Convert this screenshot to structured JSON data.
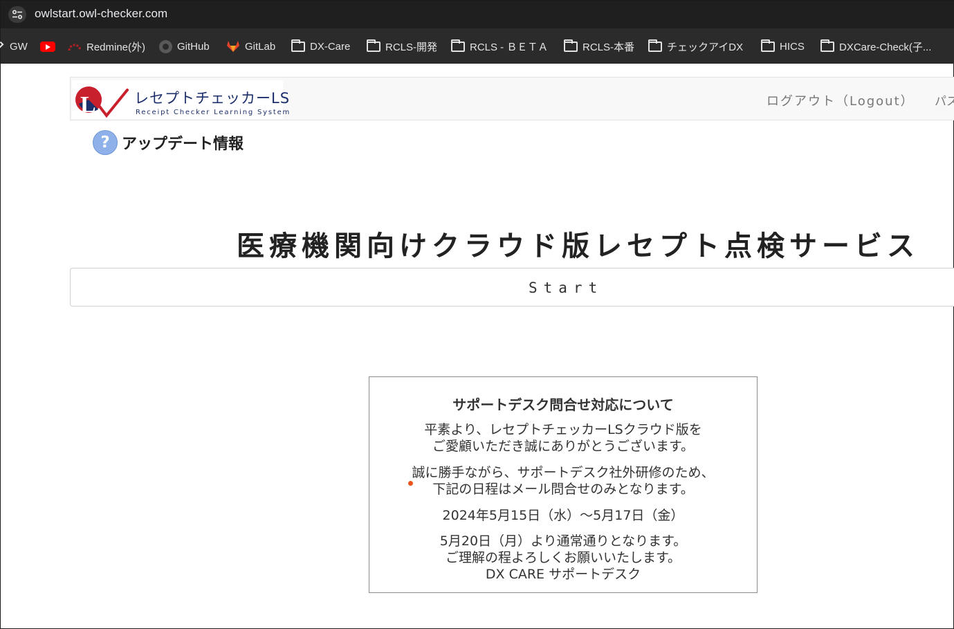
{
  "browser": {
    "url": "owlstart.owl-checker.com",
    "bookmarks": [
      {
        "label": "GW",
        "icon": "partial-icon"
      },
      {
        "label": "",
        "icon": "youtube-icon"
      },
      {
        "label": "Redmine(外)",
        "icon": "redmine-icon"
      },
      {
        "label": "GitHub",
        "icon": "github-icon"
      },
      {
        "label": "GitLab",
        "icon": "gitlab-icon"
      },
      {
        "label": "DX-Care",
        "icon": "folder-icon"
      },
      {
        "label": "RCLS-開発",
        "icon": "folder-icon"
      },
      {
        "label": "RCLS - ＢＥＴＡ",
        "icon": "folder-icon"
      },
      {
        "label": "RCLS-本番",
        "icon": "folder-icon"
      },
      {
        "label": "チェックアイDX",
        "icon": "folder-icon"
      },
      {
        "label": "HICS",
        "icon": "folder-icon"
      },
      {
        "label": "DXCare-Check(子...",
        "icon": "folder-icon"
      }
    ]
  },
  "header": {
    "logo_title": "レセプトチェッカーLS",
    "logo_subtitle": "Receipt Checker Learning System",
    "logout": "ログアウト（Logout）",
    "next_link": "パス"
  },
  "update_link": "アップデート情報",
  "main": {
    "title": "医療機関向けクラウド版レセプト点検サービス",
    "start_label": "Start"
  },
  "notice": {
    "title": "サポートデスク問合せ対応について",
    "para1_line1": "平素より、レセプトチェッカーLSクラウド版を",
    "para1_line2": "ご愛顧いただき誠にありがとうございます。",
    "para2_line1": "誠に勝手ながら、サポートデスク社外研修のため、",
    "para2_line2": "下記の日程はメール問合せのみとなります。",
    "dates": "2024年5月15日（水）～5月17日（金）",
    "para3_line1": "5月20日（月）より通常通りとなります。",
    "para3_line2": "ご理解の程よろしくお願いいたします。",
    "signature": "DX CARE サポートデスク"
  },
  "colors": {
    "logo_navy": "#1d2f6b",
    "logo_red": "#c8202c",
    "help_icon_blue": "#8eb1ea",
    "bullet_orange": "#e8541b"
  }
}
